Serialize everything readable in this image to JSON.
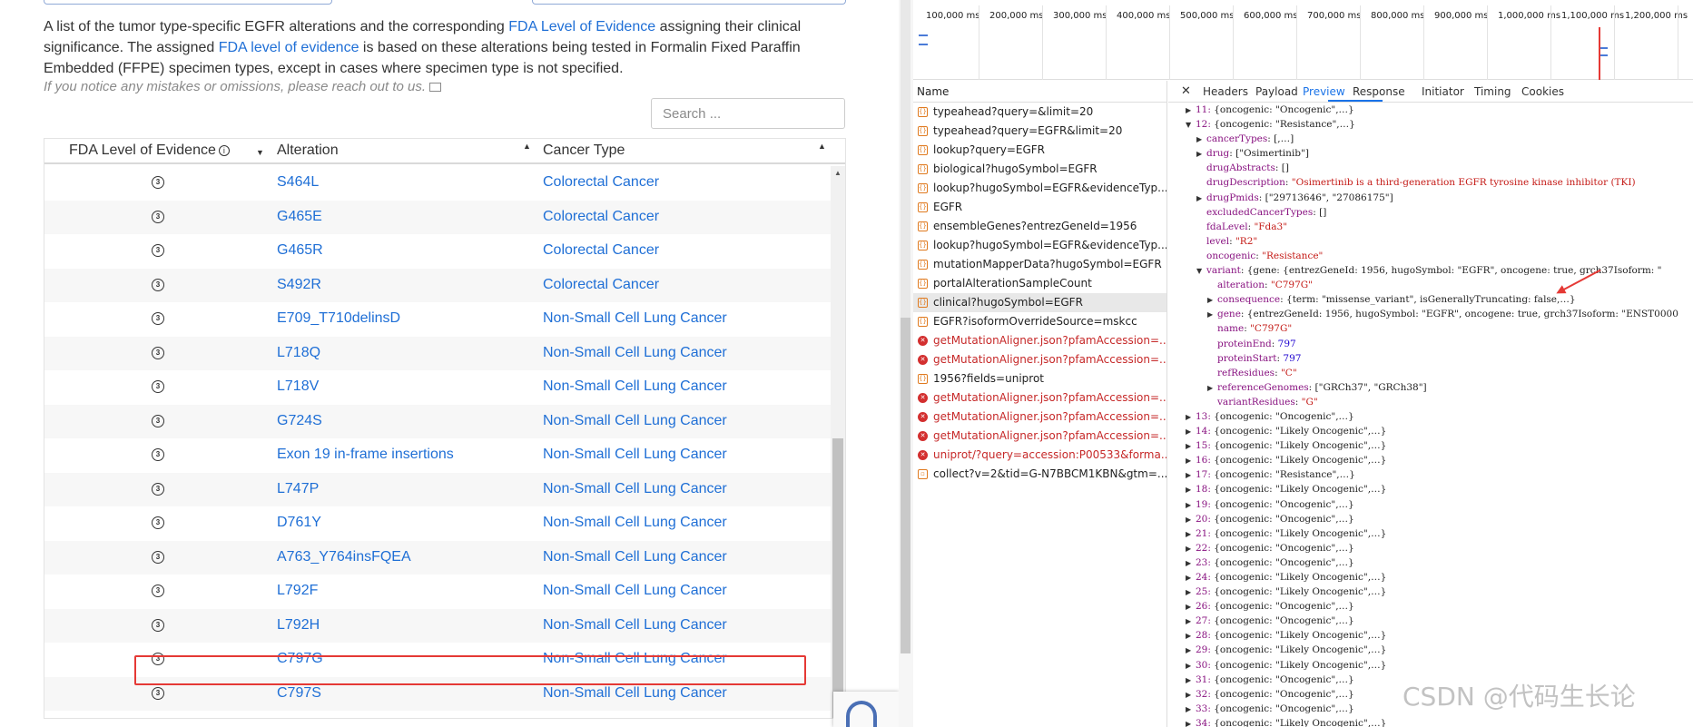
{
  "description": {
    "p1": "A list of the tumor type-specific EGFR alterations and the corresponding ",
    "link1": "FDA Level of Evidence",
    "p2": " assigning their clinical significance. The assigned ",
    "link2": "FDA level of evidence",
    "p3": " is based on these alterations being tested in Formalin Fixed Paraffin Embedded (FFPE) specimen types, except in cases where specimen type is not specified.",
    "note": "If you notice any mistakes or omissions, please reach out to us."
  },
  "search": {
    "placeholder": "Search ..."
  },
  "table": {
    "headers": {
      "level": "FDA Level of Evidence",
      "alteration": "Alteration",
      "cancer": "Cancer Type"
    },
    "level_icon": "3",
    "rows": [
      {
        "alteration": "S464L",
        "cancer": "Colorectal Cancer"
      },
      {
        "alteration": "G465E",
        "cancer": "Colorectal Cancer"
      },
      {
        "alteration": "G465R",
        "cancer": "Colorectal Cancer"
      },
      {
        "alteration": "S492R",
        "cancer": "Colorectal Cancer"
      },
      {
        "alteration": "E709_T710delinsD",
        "cancer": "Non-Small Cell Lung Cancer"
      },
      {
        "alteration": "L718Q",
        "cancer": "Non-Small Cell Lung Cancer"
      },
      {
        "alteration": "L718V",
        "cancer": "Non-Small Cell Lung Cancer"
      },
      {
        "alteration": "G724S",
        "cancer": "Non-Small Cell Lung Cancer"
      },
      {
        "alteration": "Exon 19 in-frame insertions",
        "cancer": "Non-Small Cell Lung Cancer"
      },
      {
        "alteration": "L747P",
        "cancer": "Non-Small Cell Lung Cancer"
      },
      {
        "alteration": "D761Y",
        "cancer": "Non-Small Cell Lung Cancer"
      },
      {
        "alteration": "A763_Y764insFQEA",
        "cancer": "Non-Small Cell Lung Cancer"
      },
      {
        "alteration": "L792F",
        "cancer": "Non-Small Cell Lung Cancer"
      },
      {
        "alteration": "L792H",
        "cancer": "Non-Small Cell Lung Cancer"
      },
      {
        "alteration": "C797G",
        "cancer": "Non-Small Cell Lung Cancer"
      },
      {
        "alteration": "C797S",
        "cancer": "Non-Small Cell Lung Cancer"
      }
    ]
  },
  "devtools": {
    "timeline_ticks": [
      "100,000 ms",
      "200,000 ms",
      "300,000 ms",
      "400,000 ms",
      "500,000 ms",
      "600,000 ms",
      "700,000 ms",
      "800,000 ms",
      "900,000 ms",
      "1,000,000 ms",
      "1,100,000 ms",
      "1,200,000 ms"
    ],
    "name_header": "Name",
    "requests": [
      {
        "name": "typeahead?query=&limit=20",
        "type": "xhr"
      },
      {
        "name": "typeahead?query=EGFR&limit=20",
        "type": "xhr"
      },
      {
        "name": "lookup?query=EGFR",
        "type": "xhr"
      },
      {
        "name": "biological?hugoSymbol=EGFR",
        "type": "xhr"
      },
      {
        "name": "lookup?hugoSymbol=EGFR&evidenceTyp...",
        "type": "xhr"
      },
      {
        "name": "EGFR",
        "type": "xhr"
      },
      {
        "name": "ensembleGenes?entrezGeneId=1956",
        "type": "xhr"
      },
      {
        "name": "lookup?hugoSymbol=EGFR&evidenceTyp...",
        "type": "xhr"
      },
      {
        "name": "mutationMapperData?hugoSymbol=EGFR",
        "type": "xhr"
      },
      {
        "name": "portalAlterationSampleCount",
        "type": "xhr"
      },
      {
        "name": "clinical?hugoSymbol=EGFR",
        "type": "xhr",
        "selected": true
      },
      {
        "name": "EGFR?isoformOverrideSource=mskcc",
        "type": "xhr"
      },
      {
        "name": "getMutationAligner.json?pfamAccession=...",
        "type": "error"
      },
      {
        "name": "getMutationAligner.json?pfamAccession=...",
        "type": "error"
      },
      {
        "name": "1956?fields=uniprot",
        "type": "xhr"
      },
      {
        "name": "getMutationAligner.json?pfamAccession=...",
        "type": "error"
      },
      {
        "name": "getMutationAligner.json?pfamAccession=...",
        "type": "error"
      },
      {
        "name": "getMutationAligner.json?pfamAccession=...",
        "type": "error"
      },
      {
        "name": "uniprot/?query=accession:P00533&forma...",
        "type": "error"
      },
      {
        "name": "collect?v=2&tid=G-N7BBCM1KBN&gtm=...",
        "type": "image"
      }
    ],
    "tabs": [
      "Headers",
      "Payload",
      "Preview",
      "Response",
      "Initiator",
      "Timing",
      "Cookies"
    ],
    "active_tab": "Preview",
    "json_lines": [
      {
        "indent": 0,
        "tri": "closed",
        "idx": "11:",
        "text": " {oncogenic: \"Oncogenic\",…}"
      },
      {
        "indent": 0,
        "tri": "open",
        "idx": "12:",
        "text": " {oncogenic: \"Resistance\",…}"
      },
      {
        "indent": 1,
        "tri": "closed",
        "key": "cancerTypes",
        "val": " [,…]",
        "vt": "p"
      },
      {
        "indent": 1,
        "tri": "closed",
        "key": "drug",
        "val": " [\"Osimertinib\"]",
        "vt": "p"
      },
      {
        "indent": 1,
        "key": "drugAbstracts",
        "val": " []",
        "vt": "p"
      },
      {
        "indent": 1,
        "key": "drugDescription",
        "val": " \"Osimertinib is a third-generation EGFR tyrosine kinase inhibitor (TKI)",
        "vt": "s"
      },
      {
        "indent": 1,
        "tri": "closed",
        "key": "drugPmids",
        "val": " [\"29713646\", \"27086175\"]",
        "vt": "p"
      },
      {
        "indent": 1,
        "key": "excludedCancerTypes",
        "val": " []",
        "vt": "p"
      },
      {
        "indent": 1,
        "key": "fdaLevel",
        "val": " \"Fda3\"",
        "vt": "s"
      },
      {
        "indent": 1,
        "key": "level",
        "val": " \"R2\"",
        "vt": "s"
      },
      {
        "indent": 1,
        "key": "oncogenic",
        "val": " \"Resistance\"",
        "vt": "s"
      },
      {
        "indent": 1,
        "tri": "open",
        "key": "variant",
        "val": " {gene: {entrezGeneId: 1956, hugoSymbol: \"EGFR\", oncogene: true, grch37Isoform: \"",
        "vt": "p"
      },
      {
        "indent": 2,
        "key": "alteration",
        "val": " \"C797G\"",
        "vt": "s"
      },
      {
        "indent": 2,
        "tri": "closed",
        "key": "consequence",
        "val": " {term: \"missense_variant\", isGenerallyTruncating: false,…}",
        "vt": "p"
      },
      {
        "indent": 2,
        "tri": "closed",
        "key": "gene",
        "val": " {entrezGeneId: 1956, hugoSymbol: \"EGFR\", oncogene: true, grch37Isoform: \"ENST0000",
        "vt": "p"
      },
      {
        "indent": 2,
        "key": "name",
        "val": " \"C797G\"",
        "vt": "s"
      },
      {
        "indent": 2,
        "key": "proteinEnd",
        "val": " 797",
        "vt": "n"
      },
      {
        "indent": 2,
        "key": "proteinStart",
        "val": " 797",
        "vt": "n"
      },
      {
        "indent": 2,
        "key": "refResidues",
        "val": " \"C\"",
        "vt": "s"
      },
      {
        "indent": 2,
        "tri": "closed",
        "key": "referenceGenomes",
        "val": " [\"GRCh37\", \"GRCh38\"]",
        "vt": "p"
      },
      {
        "indent": 2,
        "key": "variantResidues",
        "val": " \"G\"",
        "vt": "s"
      },
      {
        "indent": 0,
        "tri": "closed",
        "idx": "13:",
        "text": " {oncogenic: \"Oncogenic\",…}"
      },
      {
        "indent": 0,
        "tri": "closed",
        "idx": "14:",
        "text": " {oncogenic: \"Likely Oncogenic\",…}"
      },
      {
        "indent": 0,
        "tri": "closed",
        "idx": "15:",
        "text": " {oncogenic: \"Likely Oncogenic\",…}"
      },
      {
        "indent": 0,
        "tri": "closed",
        "idx": "16:",
        "text": " {oncogenic: \"Likely Oncogenic\",…}"
      },
      {
        "indent": 0,
        "tri": "closed",
        "idx": "17:",
        "text": " {oncogenic: \"Resistance\",…}"
      },
      {
        "indent": 0,
        "tri": "closed",
        "idx": "18:",
        "text": " {oncogenic: \"Likely Oncogenic\",…}"
      },
      {
        "indent": 0,
        "tri": "closed",
        "idx": "19:",
        "text": " {oncogenic: \"Oncogenic\",…}"
      },
      {
        "indent": 0,
        "tri": "closed",
        "idx": "20:",
        "text": " {oncogenic: \"Oncogenic\",…}"
      },
      {
        "indent": 0,
        "tri": "closed",
        "idx": "21:",
        "text": " {oncogenic: \"Likely Oncogenic\",…}"
      },
      {
        "indent": 0,
        "tri": "closed",
        "idx": "22:",
        "text": " {oncogenic: \"Oncogenic\",…}"
      },
      {
        "indent": 0,
        "tri": "closed",
        "idx": "23:",
        "text": " {oncogenic: \"Oncogenic\",…}"
      },
      {
        "indent": 0,
        "tri": "closed",
        "idx": "24:",
        "text": " {oncogenic: \"Likely Oncogenic\",…}"
      },
      {
        "indent": 0,
        "tri": "closed",
        "idx": "25:",
        "text": " {oncogenic: \"Likely Oncogenic\",…}"
      },
      {
        "indent": 0,
        "tri": "closed",
        "idx": "26:",
        "text": " {oncogenic: \"Oncogenic\",…}"
      },
      {
        "indent": 0,
        "tri": "closed",
        "idx": "27:",
        "text": " {oncogenic: \"Oncogenic\",…}"
      },
      {
        "indent": 0,
        "tri": "closed",
        "idx": "28:",
        "text": " {oncogenic: \"Likely Oncogenic\",…}"
      },
      {
        "indent": 0,
        "tri": "closed",
        "idx": "29:",
        "text": " {oncogenic: \"Likely Oncogenic\",…}"
      },
      {
        "indent": 0,
        "tri": "closed",
        "idx": "30:",
        "text": " {oncogenic: \"Likely Oncogenic\",…}"
      },
      {
        "indent": 0,
        "tri": "closed",
        "idx": "31:",
        "text": " {oncogenic: \"Oncogenic\",…}"
      },
      {
        "indent": 0,
        "tri": "closed",
        "idx": "32:",
        "text": " {oncogenic: \"Oncogenic\",…}"
      },
      {
        "indent": 0,
        "tri": "closed",
        "idx": "33:",
        "text": " {oncogenic: \"Oncogenic\",…}"
      },
      {
        "indent": 0,
        "tri": "closed",
        "idx": "34:",
        "text": " {oncogenic: \"Likely Oncogenic\",…}"
      }
    ]
  },
  "watermark": "CSDN @代码生长论",
  "colors": {
    "link": "#1f6fd6",
    "highlight": "#e53935",
    "devtools_active": "#1a73e8"
  }
}
